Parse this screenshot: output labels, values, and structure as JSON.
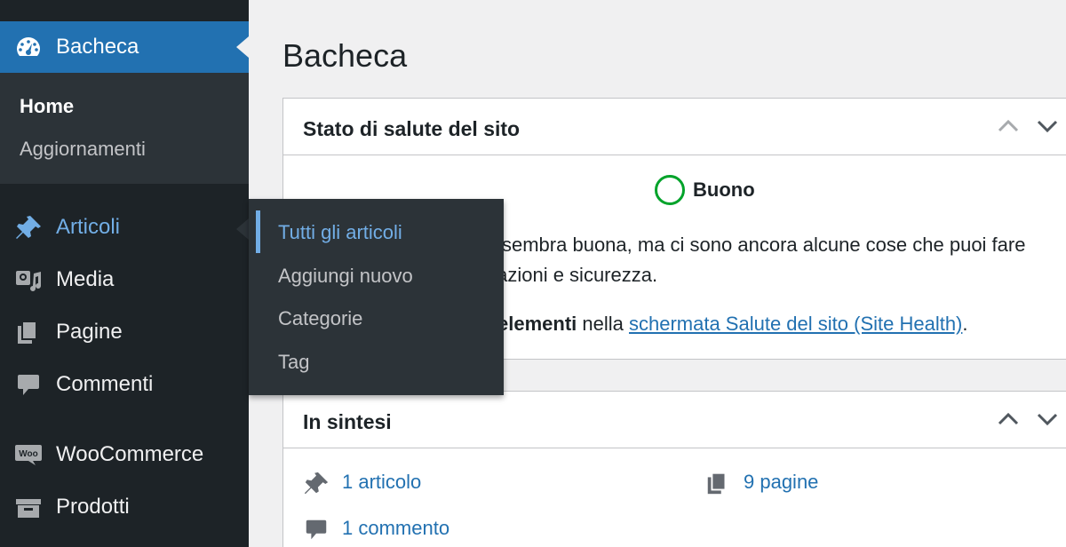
{
  "sidebar": {
    "dashboard": {
      "label": "Bacheca",
      "icon": "dashboard-icon"
    },
    "dashboard_submenu": [
      {
        "label": "Home"
      },
      {
        "label": "Aggiornamenti"
      }
    ],
    "items": [
      {
        "label": "Articoli",
        "icon": "pin-icon"
      },
      {
        "label": "Media",
        "icon": "media-icon"
      },
      {
        "label": "Pagine",
        "icon": "pages-icon"
      },
      {
        "label": "Commenti",
        "icon": "comment-icon"
      },
      {
        "label": "WooCommerce",
        "icon": "woo-icon",
        "icon_text": "Woo"
      },
      {
        "label": "Prodotti",
        "icon": "archive-icon"
      }
    ]
  },
  "flyout": {
    "items": [
      {
        "label": "Tutti gli articoli"
      },
      {
        "label": "Aggiungi nuovo"
      },
      {
        "label": "Categorie"
      },
      {
        "label": "Tag"
      }
    ]
  },
  "main": {
    "title": "Bacheca",
    "site_health": {
      "title": "Stato di salute del sito",
      "status": "Buono",
      "line1": "sembra buona, ma ci sono ancora alcune cose che puoi fare",
      "line2": "tazioni e sicurezza.",
      "line3_bold": "elementi",
      "line3_mid": " nella ",
      "line3_link": "schermata Salute del sito (Site Health)",
      "line3_end": "."
    },
    "at_a_glance": {
      "title": "In sintesi",
      "posts": "1 articolo",
      "pages": "9 pagine",
      "comments": "1 commento"
    }
  },
  "colors": {
    "sidebar_bg": "#1d2327",
    "submenu_bg": "#2c3338",
    "accent": "#2271b1",
    "hover_text": "#72aee6",
    "health_good": "#00a32a"
  }
}
